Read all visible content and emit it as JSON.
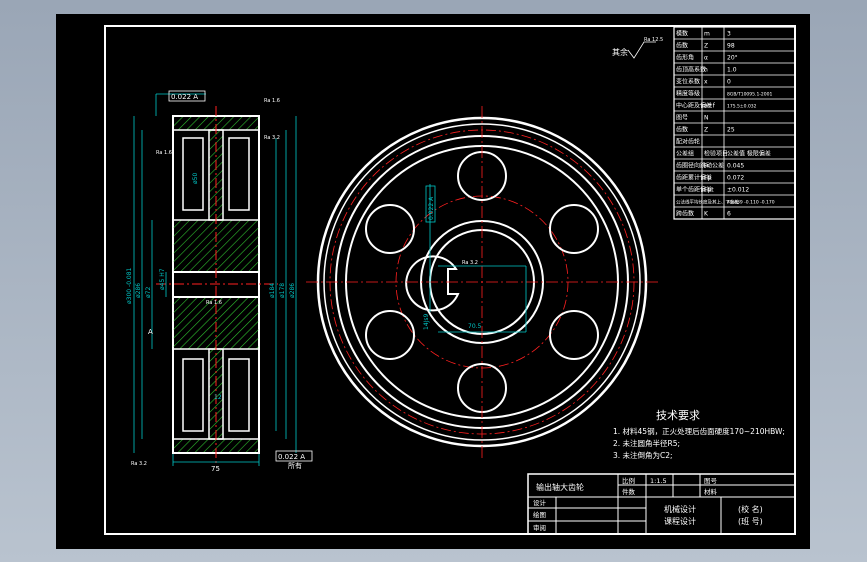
{
  "colors": {
    "background": "#000000",
    "outline": "#ffffff",
    "dimension": "#00c8c8",
    "centerline": "#ff2020",
    "hatch": "#2fbf2f",
    "window_frame": "#9aa6b6"
  },
  "roughness_note": {
    "label": "其余",
    "value": "Ra 12.5"
  },
  "param_table": {
    "rows": [
      {
        "name": "模数",
        "symbol": "m",
        "value": "3"
      },
      {
        "name": "齿数",
        "symbol": "Z",
        "value": "98"
      },
      {
        "name": "齿形角",
        "symbol": "α",
        "value": "20°"
      },
      {
        "name": "齿顶高系数",
        "symbol": "h",
        "value": "1.0"
      },
      {
        "name": "变位系数",
        "symbol": "x",
        "value": "0"
      },
      {
        "name": "精度等级",
        "symbol": "",
        "value": "8GB/T10095.1-2001"
      },
      {
        "name": "中心距及偏差",
        "symbol": "a±f",
        "value": "175.5±0.032"
      },
      {
        "name": "图号",
        "symbol": "N",
        "value": ""
      },
      {
        "name": "齿数",
        "symbol": "Z",
        "value": "25"
      },
      {
        "name": "配对齿轮",
        "symbol": "",
        "value": ""
      },
      {
        "name": "公差组",
        "symbol": "检验项目",
        "value": "公差值 极限偏差"
      },
      {
        "name": "齿圈径向跳动公差",
        "symbol": "Fr",
        "value": "0.045"
      },
      {
        "name": "齿距累计偏差",
        "symbol": "Fp",
        "value": "0.072"
      },
      {
        "name": "单个齿距偏差",
        "symbol": "Fpt",
        "value": "±0.012"
      },
      {
        "name": "公法线平均长度及其上、下偏差",
        "symbol": "",
        "value": "42.439 -0.110 -0.170"
      },
      {
        "name": "跨齿数",
        "symbol": "K",
        "value": "6"
      }
    ]
  },
  "tech_requirements": {
    "title": "技术要求",
    "items": [
      "1. 材料45钢，正火处理后齿面硬度170~210HBW;",
      "2. 未注圆角半径R5;",
      "3. 未注倒角为C2;"
    ]
  },
  "title_block": {
    "drawing_name": "输出轴大齿轮",
    "scale_label": "比例",
    "scale_value": "1:1.5",
    "drawing_no_label": "图号",
    "quantity_label": "件数",
    "material_label": "材料",
    "designer_label": "设计",
    "drawer_label": "绘图",
    "reviewer_label": "审阅",
    "course_line1": "机械设计",
    "course_line2": "课程设计",
    "school_line1": "(校 名)",
    "school_line2": "(班 号)"
  },
  "section_view": {
    "width_dim": "75",
    "tolerance_top": "0.022 A",
    "tolerance_bottom": "0.022 A",
    "datum_label": "A",
    "bore_dim": "ø45 H7",
    "hub_dim": "ø72",
    "web_dim_1": "ø184",
    "web_dim_2": "ø178",
    "root_dim": "ø286",
    "tip_dim": "ø300 -0.081",
    "hole_dim": "ø50",
    "bottom_note": "所有",
    "roughness_1": "Ra 1.6",
    "roughness_2": "Ra 3.2",
    "roughness_3": "Ra 1.6",
    "roughness_4": "Ra 3.2",
    "roughness_5": "Ra 1.6",
    "dim_12": "12"
  },
  "front_view": {
    "keyway_tolerance": "0.022 A",
    "keyway_width": "14Js9",
    "keyway_depth": "70.5",
    "keyway_roughness": "Ra 3.2"
  }
}
